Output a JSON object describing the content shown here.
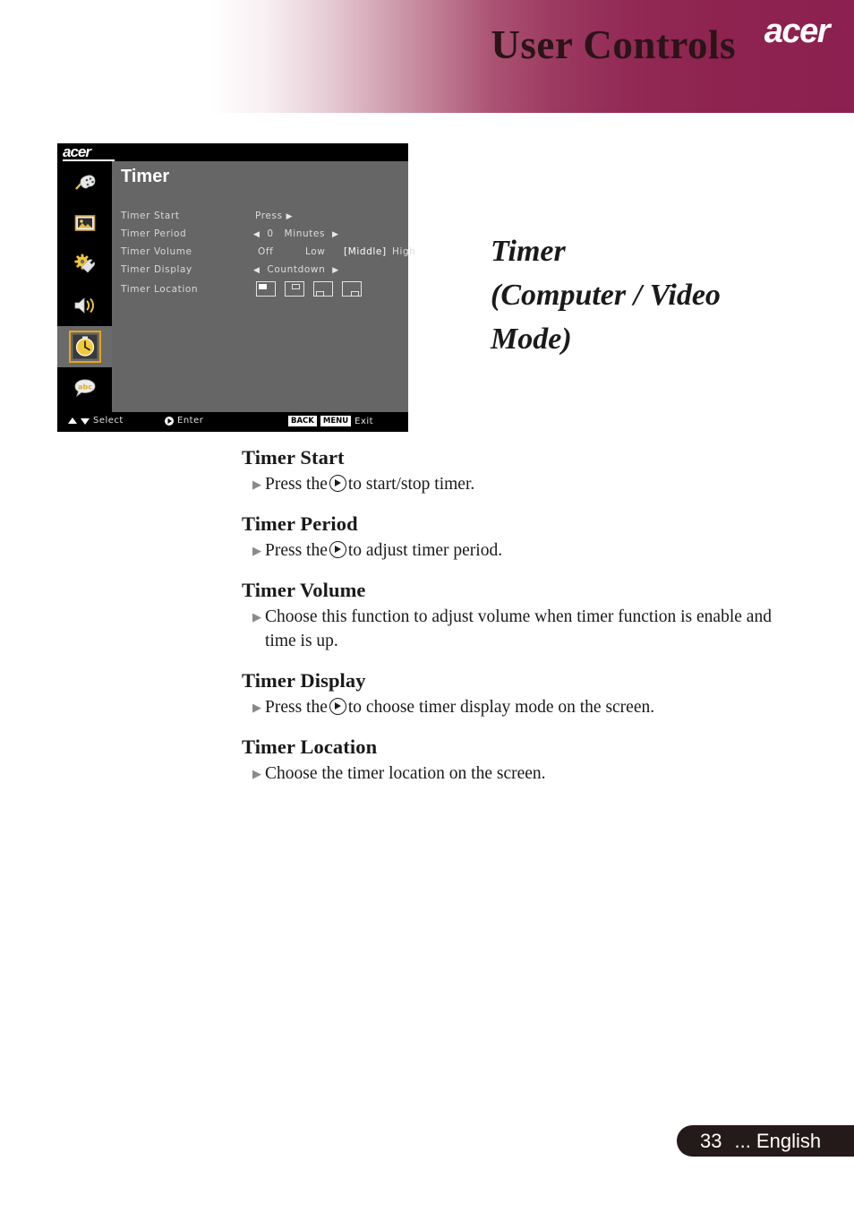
{
  "header": {
    "title": "User Controls",
    "logo": "acer",
    "accent_color": "#8c2050"
  },
  "osd": {
    "logo": "acer",
    "heading": "Timer",
    "sidebar": [
      {
        "name": "color-settings",
        "icon": "palette-icon",
        "selected": false
      },
      {
        "name": "image-settings",
        "icon": "picture-icon",
        "selected": false
      },
      {
        "name": "management-settings",
        "icon": "gear-wrench-icon",
        "selected": false
      },
      {
        "name": "audio-settings",
        "icon": "speaker-icon",
        "selected": false
      },
      {
        "name": "timer-settings",
        "icon": "clock-icon",
        "selected": true
      },
      {
        "name": "language-settings",
        "icon": "abc-bubble-icon",
        "selected": false
      }
    ],
    "highlight_color": "#e8a317",
    "rows": [
      {
        "label": "Timer Start",
        "value": "Press",
        "type": "press"
      },
      {
        "label": "Timer Period",
        "value": "0",
        "unit": "Minutes",
        "type": "spinner"
      },
      {
        "label": "Timer Volume",
        "type": "options",
        "options": [
          "Off",
          "Low",
          "[Middle]",
          "High"
        ],
        "selected": "[Middle]"
      },
      {
        "label": "Timer Display",
        "value": "Countdown",
        "type": "spinner-text"
      },
      {
        "label": "Timer Location",
        "type": "locations",
        "locations": [
          "top-left",
          "top-center",
          "bottom-left",
          "bottom-center"
        ]
      }
    ],
    "footer": {
      "select": "Select",
      "enter": "Enter",
      "back_key": "BACK",
      "menu_key": "MENU",
      "exit": "Exit"
    }
  },
  "side_title": {
    "line1": "Timer",
    "line2": "(Computer / Video",
    "line3": "Mode)"
  },
  "sections": [
    {
      "heading": "Timer Start",
      "bullets": [
        {
          "pre": "Press the",
          "has_icon": true,
          "post": "to start/stop timer."
        }
      ]
    },
    {
      "heading": "Timer Period",
      "bullets": [
        {
          "pre": "Press the",
          "has_icon": true,
          "post": "to adjust timer period."
        }
      ]
    },
    {
      "heading": "Timer Volume",
      "bullets": [
        {
          "pre": "Choose this function to adjust volume when timer function is enable and time is up.",
          "has_icon": false,
          "post": ""
        }
      ]
    },
    {
      "heading": "Timer Display",
      "bullets": [
        {
          "pre": "Press the",
          "has_icon": true,
          "post": "to choose timer display mode on the screen."
        }
      ]
    },
    {
      "heading": "Timer Location",
      "bullets": [
        {
          "pre": "Choose the timer location on the screen.",
          "has_icon": false,
          "post": ""
        }
      ]
    }
  ],
  "page_footer": {
    "page_number": "33",
    "language": "... English"
  }
}
